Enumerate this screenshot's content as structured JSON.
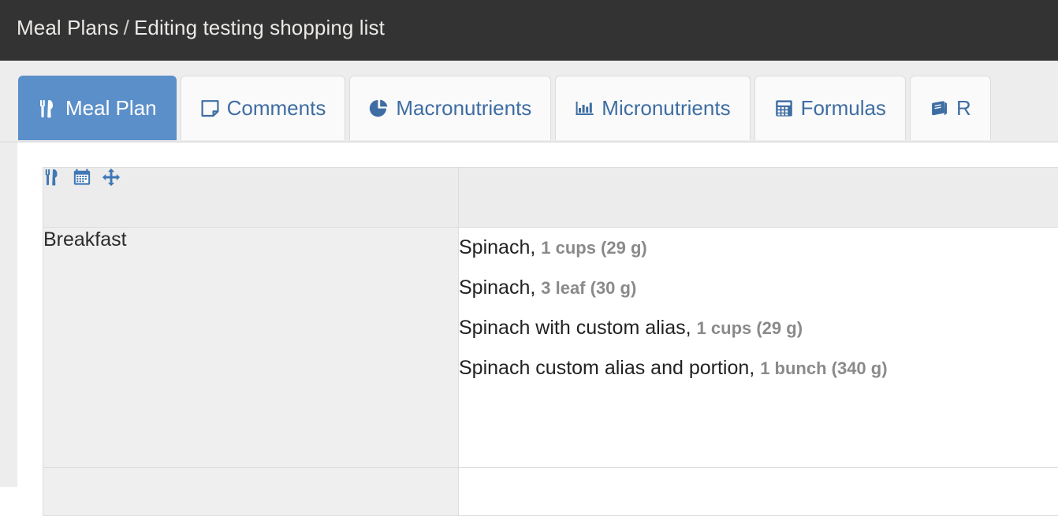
{
  "header": {
    "breadcrumb_root": "Meal Plans",
    "breadcrumb_separator": "/",
    "breadcrumb_current": "Editing testing shopping list",
    "background_color": "#333333",
    "text_color": "#e8e6e3"
  },
  "tabs": {
    "accent_color": "#5b8fc9",
    "link_color": "#3e6da3",
    "items": [
      {
        "label": "Meal Plan",
        "icon": "utensils-icon",
        "active": true
      },
      {
        "label": "Comments",
        "icon": "sticky-note-icon",
        "active": false
      },
      {
        "label": "Macronutrients",
        "icon": "pie-chart-icon",
        "active": false
      },
      {
        "label": "Micronutrients",
        "icon": "bar-chart-icon",
        "active": false
      },
      {
        "label": "Formulas",
        "icon": "calculator-icon",
        "active": false
      },
      {
        "label": "R",
        "icon": "book-icon",
        "active": false
      }
    ]
  },
  "table": {
    "header_icons": [
      {
        "name": "utensils-icon",
        "title": "Meals"
      },
      {
        "name": "calendar-icon",
        "title": "Calendar"
      },
      {
        "name": "move-arrows-icon",
        "title": "Reorder"
      }
    ],
    "rows": [
      {
        "meal": "Breakfast",
        "foods": [
          {
            "name": "Spinach,",
            "quantity": "1 cups (29 g)"
          },
          {
            "name": "Spinach,",
            "quantity": "3 leaf (30 g)"
          },
          {
            "name": "Spinach with custom alias,",
            "quantity": "1 cups (29 g)"
          },
          {
            "name": "Spinach custom alias and portion,",
            "quantity": "1 bunch (340 g)"
          }
        ]
      },
      {
        "meal": "",
        "foods": []
      }
    ]
  }
}
